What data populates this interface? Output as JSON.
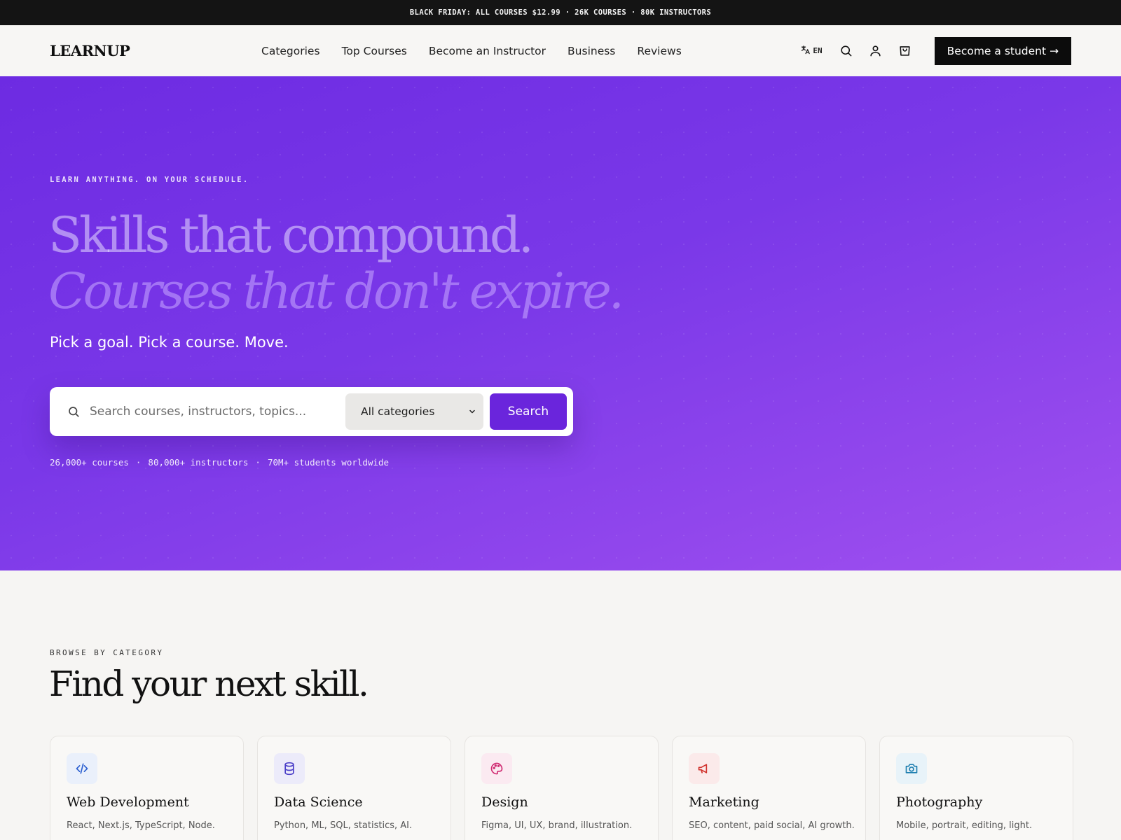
{
  "announcement": "BLACK FRIDAY: ALL COURSES $12.99 · 26K COURSES · 80K INSTRUCTORS",
  "header": {
    "logo": "LEARNUP",
    "nav": [
      "Categories",
      "Top Courses",
      "Become an Instructor",
      "Business",
      "Reviews"
    ],
    "lang_label": "EN",
    "icons": [
      "translate-icon",
      "search-icon",
      "user-icon",
      "cart-icon"
    ],
    "cta_label": "Become a student →"
  },
  "hero": {
    "eyebrow": "LEARN ANYTHING. ON YOUR SCHEDULE.",
    "headline_line1": "Skills that compound.",
    "headline_line2": "Courses that don't expire.",
    "subheadline": "Pick a goal. Pick a course. Move.",
    "search": {
      "placeholder": "Search courses, instructors, topics...",
      "category_selected": "All categories",
      "button_label": "Search"
    },
    "stats": [
      "26,000+ courses",
      "80,000+ instructors",
      "70M+ students worldwide"
    ]
  },
  "categories_section": {
    "eyebrow": "BROWSE BY CATEGORY",
    "title": "Find your next skill.",
    "cards": [
      {
        "title": "Web Development",
        "desc": "React, Next.js, TypeScript, Node.",
        "icon": "code-icon",
        "color": "#2b5fd0",
        "bg": "#eaf0fb"
      },
      {
        "title": "Data Science",
        "desc": "Python, ML, SQL, statistics, AI.",
        "icon": "database-icon",
        "color": "#4b3fc8",
        "bg": "#ecebfa"
      },
      {
        "title": "Design",
        "desc": "Figma, UI, UX, brand, illustration.",
        "icon": "palette-icon",
        "color": "#d02b72",
        "bg": "#fbeaf1"
      },
      {
        "title": "Marketing",
        "desc": "SEO, content, paid social, AI growth.",
        "icon": "megaphone-icon",
        "color": "#d0302b",
        "bg": "#fbeaea"
      },
      {
        "title": "Photography",
        "desc": "Mobile, portrait, editing, light.",
        "icon": "camera-icon",
        "color": "#1f7fb0",
        "bg": "#e8f3f9"
      }
    ]
  }
}
